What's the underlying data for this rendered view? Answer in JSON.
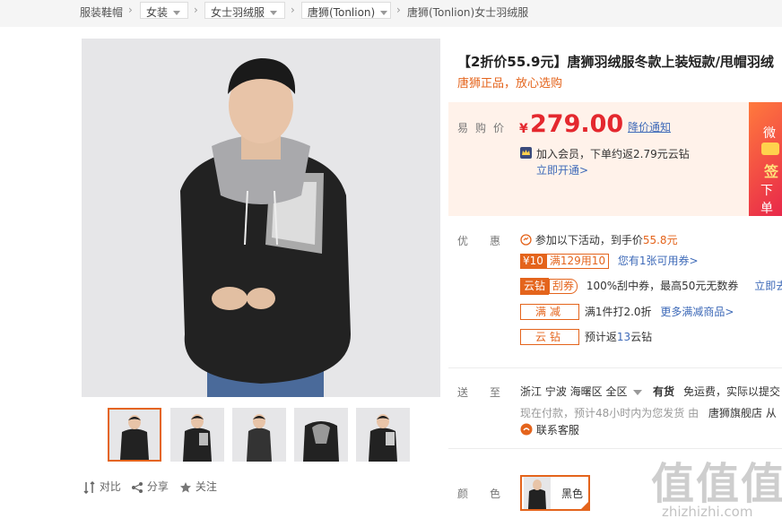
{
  "breadcrumb": {
    "root": "服装鞋帽",
    "level1": "女装",
    "level2": "女士羽绒服",
    "level3": "唐狮(Tonlion)",
    "current": "唐狮(Tonlion)女士羽绒服"
  },
  "product": {
    "title": "【2折价55.9元】唐狮羽绒服冬款上装短款/甩帽羽绒",
    "subtitle": "唐狮正品，放心选购"
  },
  "price": {
    "label": "易购价",
    "currency": "¥",
    "value": "279.00",
    "notify_link": "降价通知",
    "member_text": "加入会员，下单约返2.79元云钻",
    "member_link": "立即开通>",
    "side_banner": [
      "微",
      "签",
      "下单"
    ]
  },
  "discount": {
    "label": "优惠",
    "activity_text_prefix": "参加以下活动，到手价",
    "activity_price": "55.8元",
    "coupon_value": "¥10",
    "coupon_rule": "满129用10",
    "coupon_link": "您有1张可用券>",
    "yunzuan_tag": "云钻",
    "scratch_tag": "刮券",
    "scratch_text": "100%刮中券，最高50元无数券",
    "scratch_link": "立即去",
    "manjian_tag": "满减",
    "manjian_text": "满1件打2.0折",
    "manjian_link": "更多满减商品>",
    "yunzuan2_tag": "云钻",
    "yunzuan2_text_prefix": "预计返",
    "yunzuan2_count": "13",
    "yunzuan2_text_suffix": "云钻"
  },
  "delivery": {
    "label": "送至",
    "region": "浙江 宁波 海曙区 全区",
    "stock": "有货",
    "shipping": "免运费，实际以提交",
    "eta": "现在付款，预计48小时内为您发货  由",
    "seller": "唐狮旗舰店 从",
    "service": "联系客服"
  },
  "actions": {
    "compare": "对比",
    "share": "分享",
    "follow": "关注"
  },
  "color": {
    "label": "颜色",
    "selected": "黑色"
  },
  "watermark": {
    "big": "值值值",
    "url": "zhizhizhi.com"
  },
  "colors": {
    "accent": "#e4641c",
    "price_red": "#e4282e",
    "link_blue": "#3e6ab8"
  }
}
